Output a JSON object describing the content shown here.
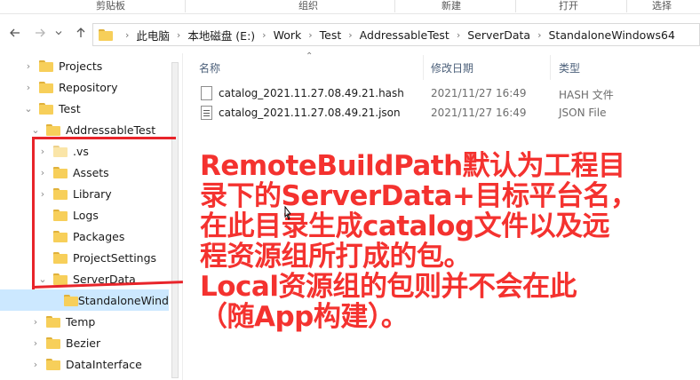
{
  "ribbon": {
    "groups": [
      "剪贴板",
      "组织",
      "新建",
      "打开",
      "选择"
    ]
  },
  "nav": {
    "back_icon": "arrow-left-icon",
    "forward_icon": "arrow-right-icon",
    "recent_icon": "chevron-down-icon",
    "up_icon": "arrow-up-icon",
    "breadcrumbs": [
      "此电脑",
      "本地磁盘 (E:)",
      "Work",
      "Test",
      "AddressableTest",
      "ServerData",
      "StandaloneWindows64"
    ]
  },
  "tree": {
    "items": [
      {
        "label": "Projects",
        "expanded": false
      },
      {
        "label": "Repository",
        "expanded": false
      },
      {
        "label": "Test",
        "expanded": true
      },
      {
        "label": "AddressableTest",
        "expanded": true
      },
      {
        "label": ".vs",
        "expanded": false
      },
      {
        "label": "Assets",
        "expanded": false
      },
      {
        "label": "Library",
        "expanded": false
      },
      {
        "label": "Logs",
        "expanded": false
      },
      {
        "label": "Packages",
        "expanded": false
      },
      {
        "label": "ProjectSettings",
        "expanded": false
      },
      {
        "label": "ServerData",
        "expanded": true
      },
      {
        "label": "StandaloneWind",
        "expanded": false
      },
      {
        "label": "Temp",
        "expanded": false
      },
      {
        "label": "Bezier",
        "expanded": false
      },
      {
        "label": "DataInterface",
        "expanded": false
      }
    ]
  },
  "list": {
    "columns": {
      "name": "名称",
      "date": "修改日期",
      "type": "类型"
    },
    "rows": [
      {
        "name": "catalog_2021.11.27.08.49.21.hash",
        "date": "2021/11/27 16:49",
        "type": "HASH 文件"
      },
      {
        "name": "catalog_2021.11.27.08.49.21.json",
        "date": "2021/11/27 16:49",
        "type": "JSON File"
      }
    ]
  },
  "annotation": {
    "text": "RemoteBuildPath默认为工程目\n录下的ServerData+目标平台名，\n在此目录生成catalog文件以及远\n程资源组所打成的包。\nLocal资源组的包则并不会在此\n（随App构建）。",
    "color": "#f4322f"
  }
}
